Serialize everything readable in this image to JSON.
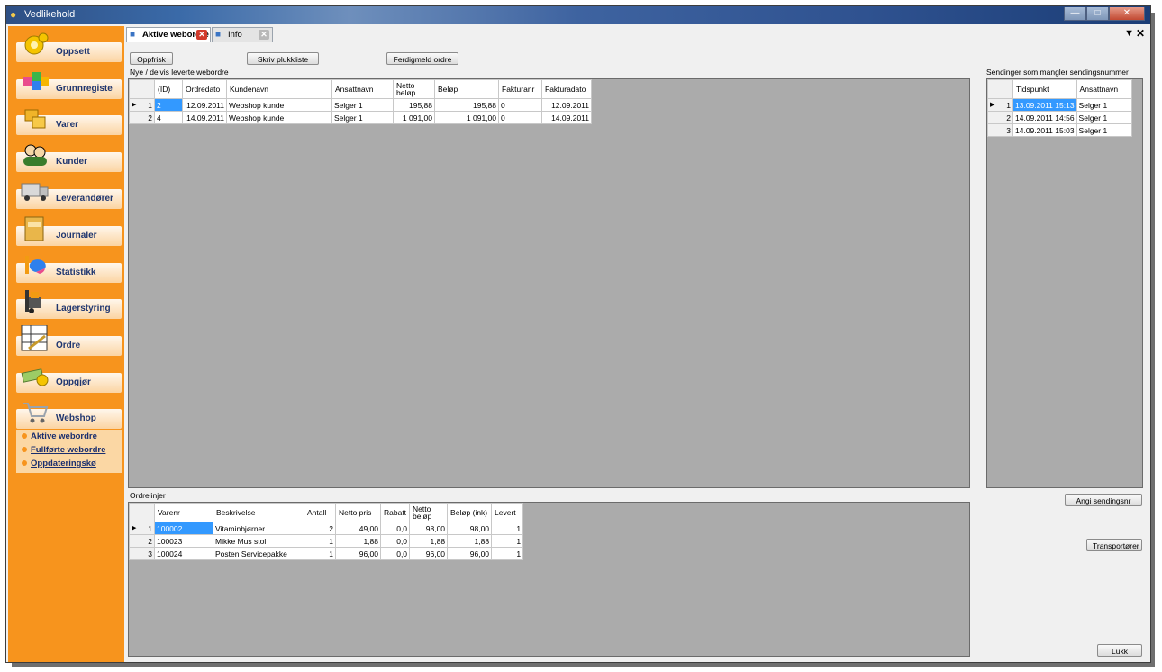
{
  "window": {
    "title": "Vedlikehold"
  },
  "sidebar": {
    "items": [
      {
        "label": "Oppsett",
        "icon": "gear-icon"
      },
      {
        "label": "Grunnregiste",
        "icon": "blocks-icon"
      },
      {
        "label": "Varer",
        "icon": "boxes-icon"
      },
      {
        "label": "Kunder",
        "icon": "people-icon"
      },
      {
        "label": "Leverandører",
        "icon": "truck-icon"
      },
      {
        "label": "Journaler",
        "icon": "folder-icon"
      },
      {
        "label": "Statistikk",
        "icon": "chart-icon"
      },
      {
        "label": "Lagerstyring",
        "icon": "forklift-icon"
      },
      {
        "label": "Ordre",
        "icon": "order-form-icon"
      },
      {
        "label": "Oppgjør",
        "icon": "money-icon"
      },
      {
        "label": "Webshop",
        "icon": "cart-icon"
      }
    ],
    "sub_items": [
      "Aktive webordre",
      "Fullførte webordre",
      "Oppdateringskø"
    ]
  },
  "tabs": [
    {
      "label": "Aktive webordre"
    },
    {
      "label": "Info"
    }
  ],
  "toolbar": {
    "refresh": "Oppfrisk",
    "print_picklist": "Skriv plukkliste",
    "complete_order": "Ferdigmeld ordre"
  },
  "orders": {
    "label": "Nye / delvis leverte webordre",
    "columns": [
      "(ID)",
      "Ordredato",
      "Kundenavn",
      "Ansattnavn",
      "Netto beløp",
      "Beløp",
      "Fakturanr",
      "Fakturadato"
    ],
    "rows": [
      {
        "n": "1",
        "id": "2",
        "date": "12.09.2011",
        "customer": "Webshop kunde",
        "employee": "Selger 1",
        "net": "195,88",
        "amount": "195,88",
        "invoice_no": "0",
        "invoice_date": "12.09.2011"
      },
      {
        "n": "2",
        "id": "4",
        "date": "14.09.2011",
        "customer": "Webshop kunde",
        "employee": "Selger 1",
        "net": "1 091,00",
        "amount": "1 091,00",
        "invoice_no": "0",
        "invoice_date": "14.09.2011"
      }
    ]
  },
  "shipments": {
    "label": "Sendinger som mangler sendingsnummer",
    "columns": [
      "Tidspunkt",
      "Ansattnavn"
    ],
    "rows": [
      {
        "n": "1",
        "time": "13.09.2011 15:13",
        "employee": "Selger 1"
      },
      {
        "n": "2",
        "time": "14.09.2011 14:56",
        "employee": "Selger 1"
      },
      {
        "n": "3",
        "time": "14.09.2011 15:03",
        "employee": "Selger 1"
      }
    ],
    "set_number_button": "Angi sendingsnr",
    "carriers_button": "Transportører",
    "close_button": "Lukk"
  },
  "lines": {
    "label": "Ordrelinjer",
    "columns": [
      "Varenr",
      "Beskrivelse",
      "Antall",
      "Netto pris",
      "Rabatt",
      "Netto beløp",
      "Beløp (ink)",
      "Levert"
    ],
    "rows": [
      {
        "n": "1",
        "item_no": "100002",
        "desc": "Vitaminbjørner",
        "qty": "2",
        "net_price": "49,00",
        "discount": "0,0",
        "net_amount": "98,00",
        "amount": "98,00",
        "delivered": "1"
      },
      {
        "n": "2",
        "item_no": "100023",
        "desc": "Mikke Mus stol",
        "qty": "1",
        "net_price": "1,88",
        "discount": "0,0",
        "net_amount": "1,88",
        "amount": "1,88",
        "delivered": "1"
      },
      {
        "n": "3",
        "item_no": "100024",
        "desc": "Posten Servicepakke",
        "qty": "1",
        "net_price": "96,00",
        "discount": "0,0",
        "net_amount": "96,00",
        "amount": "96,00",
        "delivered": "1"
      }
    ]
  }
}
